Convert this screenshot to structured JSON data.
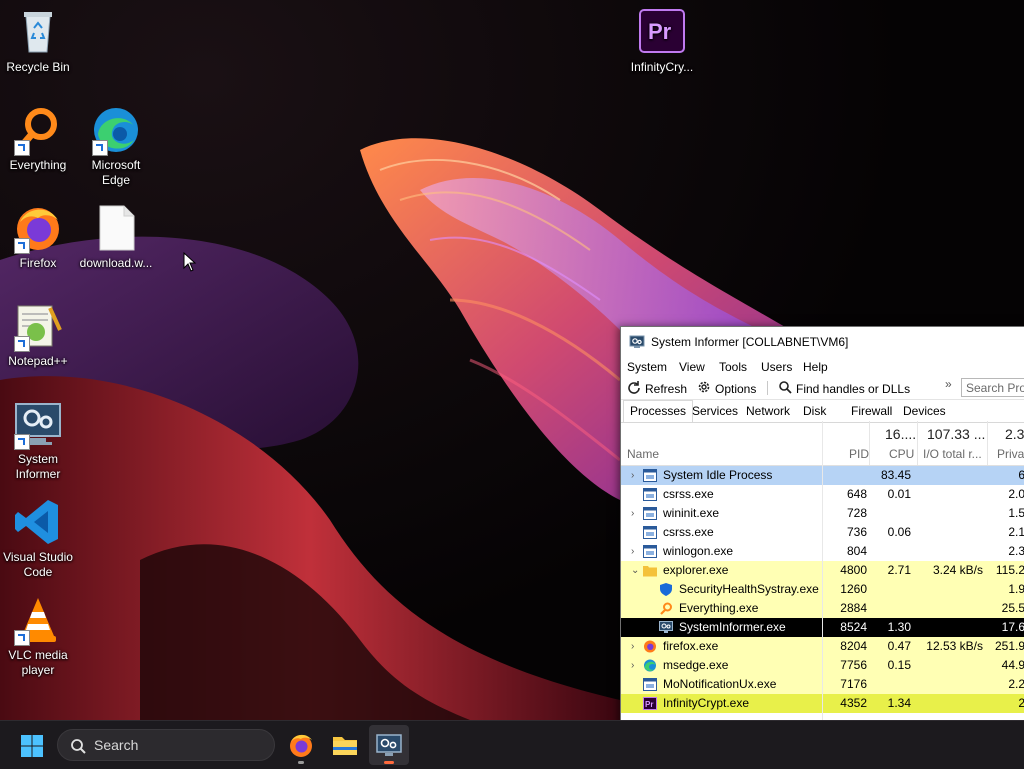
{
  "desktop": {
    "icons": [
      {
        "label": "Recycle Bin",
        "icon": "recycle-bin-icon"
      },
      {
        "label": "Everything",
        "icon": "everything-search-icon"
      },
      {
        "label": "Microsoft Edge",
        "icon": "edge-icon"
      },
      {
        "label": "Firefox",
        "icon": "firefox-icon"
      },
      {
        "label": "download.w...",
        "icon": "file-icon"
      },
      {
        "label": "Notepad++",
        "icon": "notepadpp-icon"
      },
      {
        "label": "System Informer",
        "icon": "system-informer-icon"
      },
      {
        "label": "Visual Studio Code",
        "icon": "vscode-icon"
      },
      {
        "label": "VLC media player",
        "icon": "vlc-icon"
      },
      {
        "label": "InfinityCry...",
        "icon": "premiere-icon"
      }
    ]
  },
  "taskbar": {
    "search_label": "Search",
    "apps": [
      "firefox-icon",
      "file-explorer-icon",
      "system-informer-icon"
    ]
  },
  "window": {
    "title": "System Informer [COLLABNET\\VM6]",
    "menu": [
      "System",
      "View",
      "Tools",
      "Users",
      "Help"
    ],
    "toolbar": {
      "refresh": "Refresh",
      "options": "Options",
      "find": "Find handles or DLLs",
      "overflow": "»",
      "search_placeholder": "Search Pro"
    },
    "tabs": [
      "Processes",
      "Services",
      "Network",
      "Disk",
      "Firewall",
      "Devices"
    ],
    "selected_tab": "Processes",
    "header": {
      "cpu_total": "16....",
      "io_total": "107.33 ...",
      "private_total": "2.3",
      "col_name": "Name",
      "col_pid": "PID",
      "col_cpu": "CPU",
      "col_io": "I/O total r...",
      "col_private": "Priva"
    },
    "processes": [
      {
        "name": "System Idle Process",
        "pid": "",
        "cpu": "83.45",
        "io": "",
        "private": "6",
        "expander": "›",
        "indent": 0,
        "highlight": "#b6d3f5",
        "icon": "process-window-icon"
      },
      {
        "name": "csrss.exe",
        "pid": "648",
        "cpu": "0.01",
        "io": "",
        "private": "2.0",
        "expander": "",
        "indent": 0,
        "highlight": "",
        "icon": "process-window-icon"
      },
      {
        "name": "wininit.exe",
        "pid": "728",
        "cpu": "",
        "io": "",
        "private": "1.5",
        "expander": "›",
        "indent": 0,
        "highlight": "",
        "icon": "process-window-icon"
      },
      {
        "name": "csrss.exe",
        "pid": "736",
        "cpu": "0.06",
        "io": "",
        "private": "2.1",
        "expander": "",
        "indent": 0,
        "highlight": "",
        "icon": "process-window-icon"
      },
      {
        "name": "winlogon.exe",
        "pid": "804",
        "cpu": "",
        "io": "",
        "private": "2.3",
        "expander": "›",
        "indent": 0,
        "highlight": "",
        "icon": "process-window-icon"
      },
      {
        "name": "explorer.exe",
        "pid": "4800",
        "cpu": "2.71",
        "io": "3.24 kB/s",
        "private": "115.2",
        "expander": "⌄",
        "indent": 0,
        "highlight": "#ffffb4",
        "icon": "folder-icon"
      },
      {
        "name": "SecurityHealthSystray.exe",
        "pid": "1260",
        "cpu": "",
        "io": "",
        "private": "1.9",
        "expander": "",
        "indent": 1,
        "highlight": "#ffffb4",
        "icon": "shield-icon"
      },
      {
        "name": "Everything.exe",
        "pid": "2884",
        "cpu": "",
        "io": "",
        "private": "25.5",
        "expander": "",
        "indent": 1,
        "highlight": "#ffffb4",
        "icon": "everything-search-icon"
      },
      {
        "name": "SystemInformer.exe",
        "pid": "8524",
        "cpu": "1.30",
        "io": "",
        "private": "17.6",
        "expander": "",
        "indent": 1,
        "highlight": "#000000",
        "icon": "system-informer-icon"
      },
      {
        "name": "firefox.exe",
        "pid": "8204",
        "cpu": "0.47",
        "io": "12.53 kB/s",
        "private": "251.9",
        "expander": "›",
        "indent": 0,
        "highlight": "#ffffb4",
        "icon": "firefox-icon"
      },
      {
        "name": "msedge.exe",
        "pid": "7756",
        "cpu": "0.15",
        "io": "",
        "private": "44.9",
        "expander": "›",
        "indent": 0,
        "highlight": "#ffffb4",
        "icon": "edge-icon"
      },
      {
        "name": "MoNotificationUx.exe",
        "pid": "7176",
        "cpu": "",
        "io": "",
        "private": "2.2",
        "expander": "",
        "indent": 0,
        "highlight": "#ffffb4",
        "icon": "process-window-icon"
      },
      {
        "name": "InfinityCrypt.exe",
        "pid": "4352",
        "cpu": "1.34",
        "io": "",
        "private": "2",
        "expander": "",
        "indent": 0,
        "highlight": "#e8f04a",
        "icon": "premiere-icon"
      }
    ]
  }
}
